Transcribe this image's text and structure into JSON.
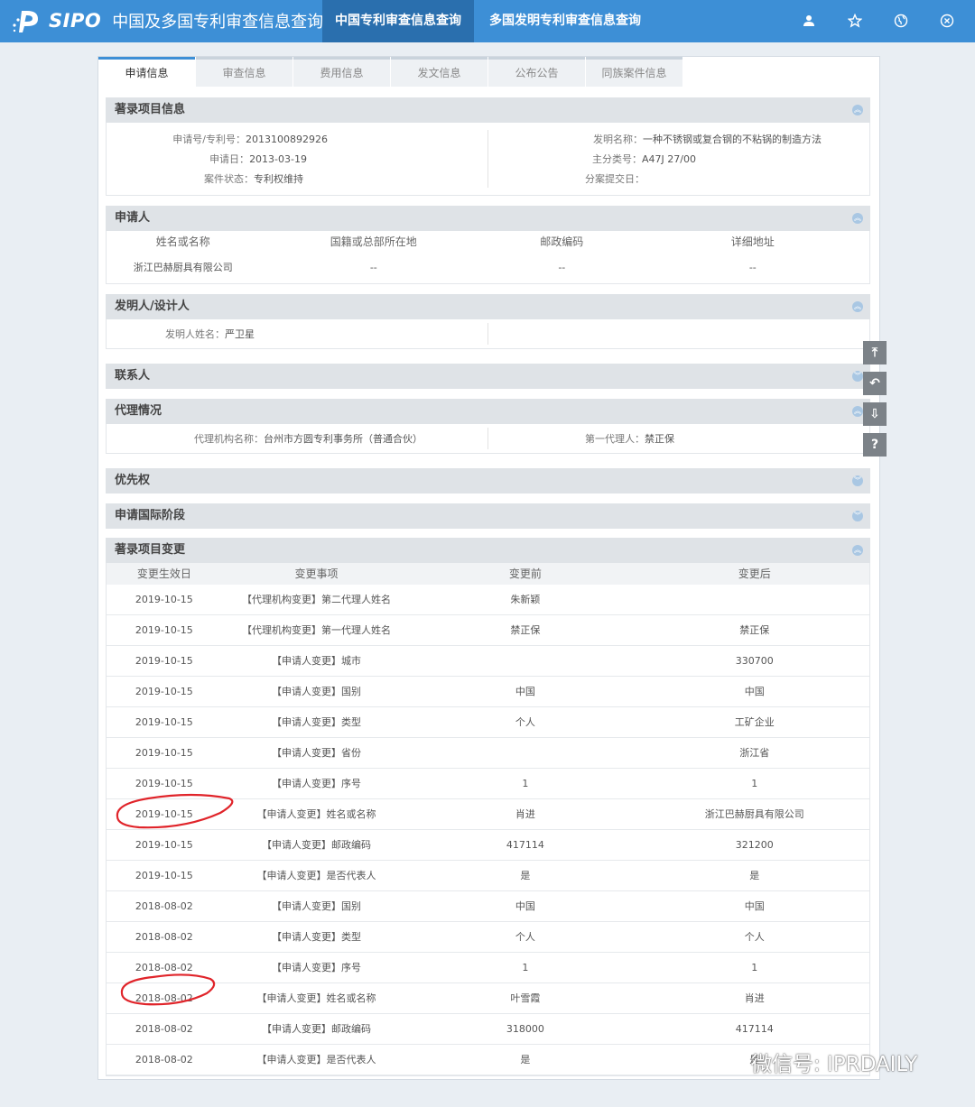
{
  "header": {
    "logo_text": "SIPO",
    "site_title": "中国及多国专利审查信息查询",
    "nav": [
      {
        "label": "中国专利审查信息查询",
        "active": true
      },
      {
        "label": "多国发明专利审查信息查询",
        "active": false
      }
    ],
    "icons": [
      "user-icon",
      "star-icon",
      "globe-icon",
      "close-icon"
    ]
  },
  "tabs": [
    "申请信息",
    "审查信息",
    "费用信息",
    "发文信息",
    "公布公告",
    "同族案件信息"
  ],
  "bib": {
    "title": "著录项目信息",
    "app_no_label": "申请号/专利号：",
    "app_no": "2013100892926",
    "app_date_label": "申请日：",
    "app_date": "2013-03-19",
    "status_label": "案件状态：",
    "status": "专利权维持",
    "invention_label": "发明名称：",
    "invention": "一种不锈钢或复合钢的不粘锅的制造方法",
    "ipc_label": "主分类号：",
    "ipc": "A47J 27/00",
    "division_label": "分案提交日：",
    "division": ""
  },
  "applicant": {
    "title": "申请人",
    "headers": [
      "姓名或名称",
      "国籍或总部所在地",
      "邮政编码",
      "详细地址"
    ],
    "rows": [
      [
        "浙江巴赫厨具有限公司",
        "--",
        "--",
        "--"
      ]
    ]
  },
  "inventor": {
    "title": "发明人/设计人",
    "label": "发明人姓名：",
    "name": "严卫星"
  },
  "contact": {
    "title": "联系人"
  },
  "agency": {
    "title": "代理情况",
    "org_label": "代理机构名称：",
    "org": "台州市方圆专利事务所（普通合伙）",
    "agent_label": "第一代理人：",
    "agent": "禁正保"
  },
  "priority": {
    "title": "优先权"
  },
  "intl": {
    "title": "申请国际阶段"
  },
  "changes": {
    "title": "著录项目变更",
    "headers": [
      "变更生效日",
      "变更事项",
      "变更前",
      "变更后"
    ],
    "rows": [
      [
        "2019-10-15",
        "【代理机构变更】第二代理人姓名",
        "朱新颖",
        ""
      ],
      [
        "2019-10-15",
        "【代理机构变更】第一代理人姓名",
        "禁正保",
        "禁正保"
      ],
      [
        "2019-10-15",
        "【申请人变更】城市",
        "",
        "330700"
      ],
      [
        "2019-10-15",
        "【申请人变更】国别",
        "中国",
        "中国"
      ],
      [
        "2019-10-15",
        "【申请人变更】类型",
        "个人",
        "工矿企业"
      ],
      [
        "2019-10-15",
        "【申请人变更】省份",
        "",
        "浙江省"
      ],
      [
        "2019-10-15",
        "【申请人变更】序号",
        "1",
        "1"
      ],
      [
        "2019-10-15",
        "【申请人变更】姓名或名称",
        "肖进",
        "浙江巴赫厨具有限公司"
      ],
      [
        "2019-10-15",
        "【申请人变更】邮政编码",
        "417114",
        "321200"
      ],
      [
        "2019-10-15",
        "【申请人变更】是否代表人",
        "是",
        "是"
      ],
      [
        "2018-08-02",
        "【申请人变更】国别",
        "中国",
        "中国"
      ],
      [
        "2018-08-02",
        "【申请人变更】类型",
        "个人",
        "个人"
      ],
      [
        "2018-08-02",
        "【申请人变更】序号",
        "1",
        "1"
      ],
      [
        "2018-08-02",
        "【申请人变更】姓名或名称",
        "叶雪霞",
        "肖进"
      ],
      [
        "2018-08-02",
        "【申请人变更】邮政编码",
        "318000",
        "417114"
      ],
      [
        "2018-08-02",
        "【申请人变更】是否代表人",
        "是",
        "是"
      ]
    ]
  },
  "side_tools": [
    {
      "icon": "back-to-top-icon",
      "glyph": "⤒"
    },
    {
      "icon": "undo-icon",
      "glyph": "↶"
    },
    {
      "icon": "download-icon",
      "glyph": "⇩"
    },
    {
      "icon": "help-icon",
      "glyph": "?"
    }
  ],
  "watermark": "微信号: IPRDAILY",
  "colors": {
    "header_bg": "#3d8fd6",
    "active_nav": "#2a6fae",
    "annotation": "#e0242a"
  }
}
